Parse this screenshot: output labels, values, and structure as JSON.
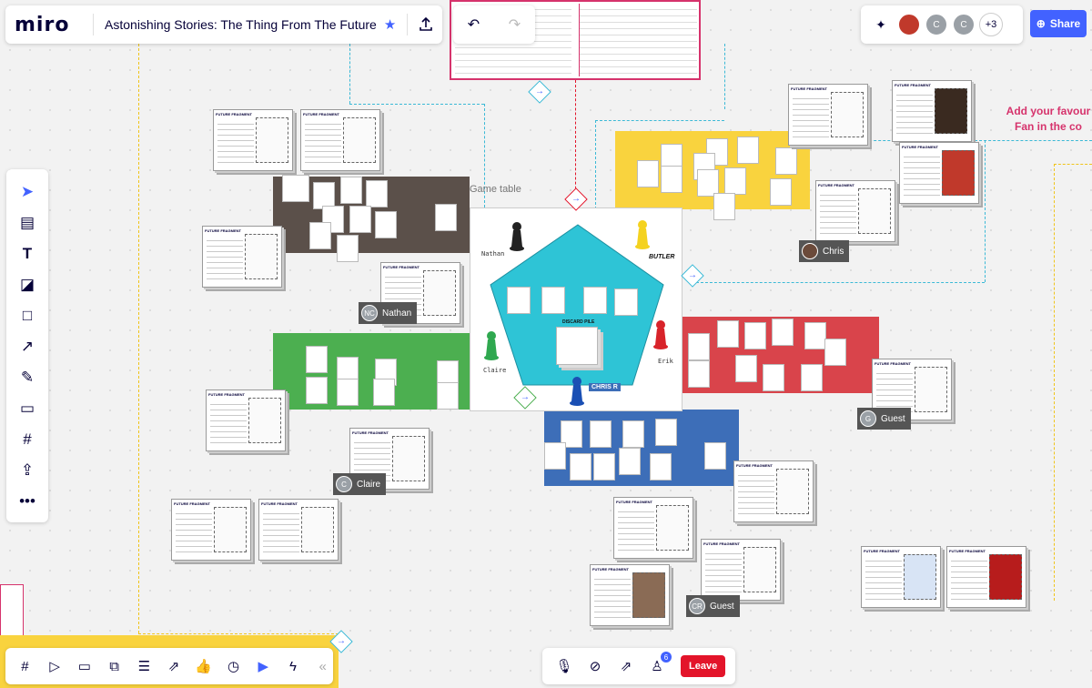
{
  "app": {
    "logo": "miro",
    "board_title": "Astonishing Stories: The Thing From The Future"
  },
  "collaborators": {
    "more_count": "+3",
    "avatar_c1": "C",
    "avatar_c2": "C"
  },
  "share_label": "Share",
  "board": {
    "game_table_label": "Game table",
    "add_favourite_text_line1": "Add your favour",
    "add_favourite_text_line2": "Fan in the co",
    "discard_pile_label": "DISCARD PILE",
    "player_labels": {
      "nathan": "Nathan",
      "butler": "BUTLER",
      "claire": "Claire",
      "erik": "Erik",
      "chris_r": "CHRIS R"
    },
    "fragment_title": "FUTURE FRAGMENT",
    "cursors": [
      {
        "initials": "NC",
        "name": "Nathan"
      },
      {
        "initials": "C",
        "name": "Claire"
      },
      {
        "initials": "",
        "name": "Chris"
      },
      {
        "initials": "G",
        "name": "Guest"
      },
      {
        "initials": "CR",
        "name": "Guest"
      }
    ]
  },
  "bottom": {
    "leave_label": "Leave",
    "participants_count": "6"
  },
  "colors": {
    "accent": "#4262ff",
    "leave": "#e3142a",
    "teal": "#2ec4d6",
    "brown": "#5b504a",
    "yellow": "#f9d33e",
    "green": "#4caf50",
    "red": "#d9444b",
    "blue": "#3d6eb8"
  }
}
